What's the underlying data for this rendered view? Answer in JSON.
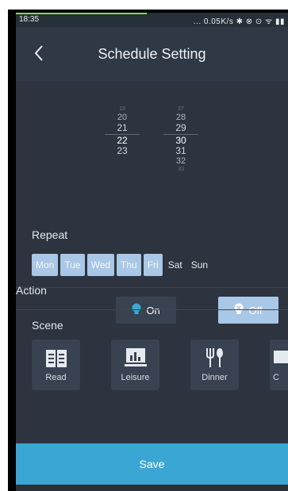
{
  "status_bar": {
    "time": "18:35",
    "network": "... 0.05K/s ✱ ⊗ ⊙ ᯤ ▮▮"
  },
  "app_bar": {
    "title": "Schedule Setting"
  },
  "time_picker": {
    "hours": [
      "19",
      "20",
      "21",
      "22",
      "23"
    ],
    "selected_hour": "22",
    "minutes": [
      "27",
      "28",
      "29",
      "30",
      "31",
      "32",
      "33"
    ],
    "selected_minute": "30"
  },
  "repeat": {
    "label": "Repeat",
    "days": [
      {
        "label": "Mon",
        "selected": true
      },
      {
        "label": "Tue",
        "selected": true
      },
      {
        "label": "Wed",
        "selected": true
      },
      {
        "label": "Thu",
        "selected": true
      },
      {
        "label": "Fri",
        "selected": true
      },
      {
        "label": "Sat",
        "selected": false
      },
      {
        "label": "Sun",
        "selected": false
      }
    ]
  },
  "action": {
    "label": "Action",
    "on_label": "On",
    "off_label": "Off",
    "selected": "Off"
  },
  "scene": {
    "label": "Scene",
    "items": [
      {
        "label": "Read",
        "icon": "book-icon"
      },
      {
        "label": "Leisure",
        "icon": "leisure-icon"
      },
      {
        "label": "Dinner",
        "icon": "dinner-icon"
      },
      {
        "label": "C",
        "icon": "scene-partial-icon"
      }
    ]
  },
  "save": {
    "label": "Save"
  },
  "colors": {
    "accent": "#3aa6d4",
    "day_selected": "#a9c7e6",
    "background": "#2d3440",
    "off_selected": "#a9c7e6"
  }
}
